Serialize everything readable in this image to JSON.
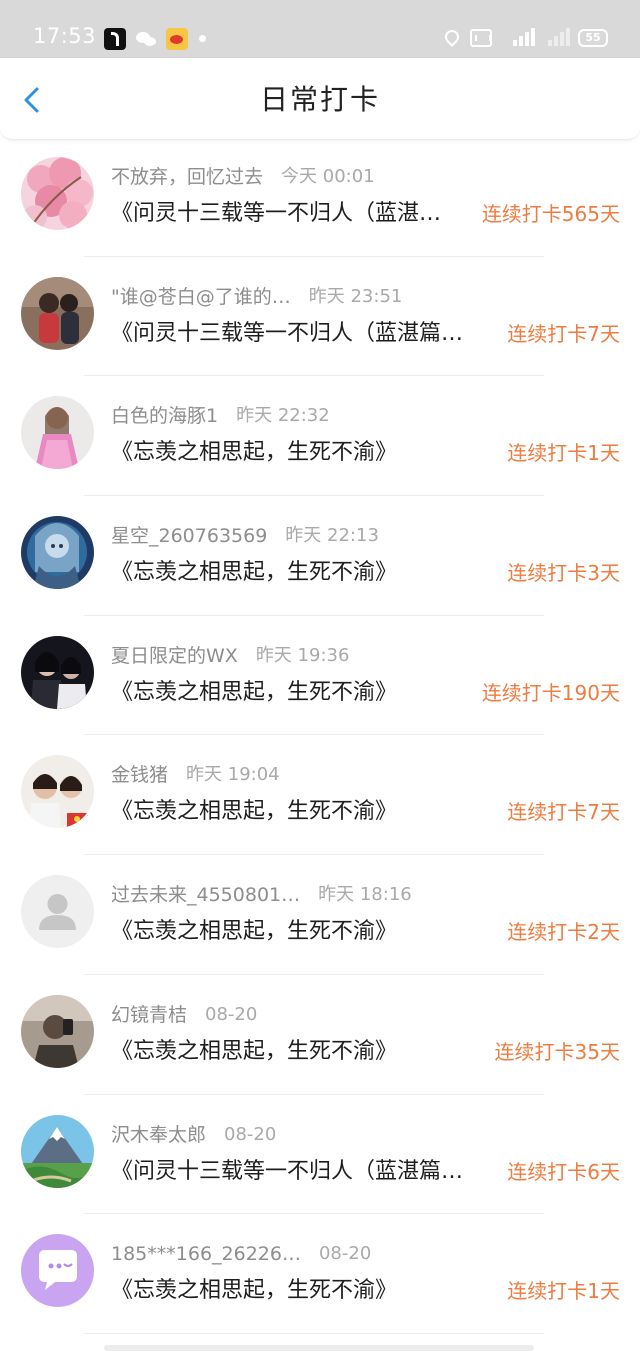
{
  "status_bar": {
    "time": "17:53",
    "battery": "55",
    "icons": [
      "tiktok-icon",
      "wechat-icon",
      "weibo-icon",
      "notification-dot",
      "location-icon",
      "hd-icon",
      "signal-4g-icon",
      "signal-icon",
      "battery-icon"
    ]
  },
  "header": {
    "title": "日常打卡",
    "back_icon": "chevron-left-icon",
    "accent_color": "#2f8fe0"
  },
  "colors": {
    "streak": "#ee7b3f",
    "name": "#8d8d8d",
    "time": "#a9a9a9"
  },
  "checkins": [
    {
      "name": "不放弃，回忆过去",
      "time": "今天 00:01",
      "book": "《问灵十三载等一不归人（蓝湛…",
      "streak": "连续打卡565天",
      "avatar": "pink-blossom-avatar"
    },
    {
      "name": "\"谁@苍白@了谁的…",
      "time": "昨天 23:51",
      "book": "《问灵十三载等一不归人（蓝湛篇…",
      "streak": "连续打卡7天",
      "avatar": "photo-avatar"
    },
    {
      "name": "白色的海豚1",
      "time": "昨天 22:32",
      "book": "《忘羡之相思起，生死不渝》",
      "streak": "连续打卡1天",
      "avatar": "photo-avatar"
    },
    {
      "name": "星空_260763569",
      "time": "昨天 22:13",
      "book": "《忘羡之相思起，生死不渝》",
      "streak": "连续打卡3天",
      "avatar": "anime-avatar"
    },
    {
      "name": "夏日限定的WX",
      "time": "昨天 19:36",
      "book": "《忘羡之相思起，生死不渝》",
      "streak": "连续打卡190天",
      "avatar": "photo-avatar"
    },
    {
      "name": "金钱猪",
      "time": "昨天 19:04",
      "book": "《忘羡之相思起，生死不渝》",
      "streak": "连续打卡7天",
      "avatar": "photo-avatar"
    },
    {
      "name": "过去未来_4550801…",
      "time": "昨天 18:16",
      "book": "《忘羡之相思起，生死不渝》",
      "streak": "连续打卡2天",
      "avatar": "default-user-icon"
    },
    {
      "name": "幻镜青桔",
      "time": "08-20",
      "book": "《忘羡之相思起，生死不渝》",
      "streak": "连续打卡35天",
      "avatar": "photo-avatar"
    },
    {
      "name": "沢木奉太郎",
      "time": "08-20",
      "book": "《问灵十三载等一不归人（蓝湛篇…",
      "streak": "连续打卡6天",
      "avatar": "mountain-landscape-avatar"
    },
    {
      "name": "185***166_26226…",
      "time": "08-20",
      "book": "《忘羡之相思起，生死不渝》",
      "streak": "连续打卡1天",
      "avatar": "chat-bubble-icon"
    }
  ]
}
